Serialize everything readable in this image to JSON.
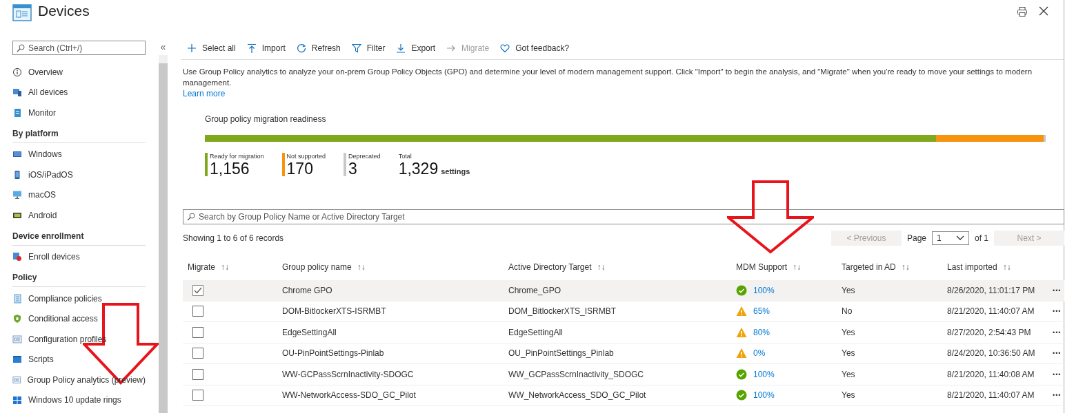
{
  "window": {
    "title": "Devices"
  },
  "sidebar": {
    "search": {
      "placeholder": "Search (Ctrl+/)"
    },
    "collapse": "«",
    "sections": [
      {
        "items": [
          {
            "label": "Overview",
            "selected": false
          },
          {
            "label": "All devices",
            "selected": false
          },
          {
            "label": "Monitor",
            "selected": false
          }
        ]
      },
      {
        "title": "By platform",
        "items": [
          {
            "label": "Windows",
            "selected": false
          },
          {
            "label": "iOS/iPadOS",
            "selected": false
          },
          {
            "label": "macOS",
            "selected": false
          },
          {
            "label": "Android",
            "selected": false
          }
        ]
      },
      {
        "title": "Device enrollment",
        "items": [
          {
            "label": "Enroll devices",
            "selected": false
          }
        ]
      },
      {
        "title": "Policy",
        "items": [
          {
            "label": "Compliance policies",
            "selected": false
          },
          {
            "label": "Conditional access",
            "selected": false
          },
          {
            "label": "Configuration profiles",
            "selected": false
          },
          {
            "label": "Scripts",
            "selected": false
          },
          {
            "label": "Group Policy analytics (preview)",
            "selected": false
          },
          {
            "label": "Windows 10 update rings",
            "selected": false
          }
        ]
      }
    ]
  },
  "toolbar": [
    {
      "label": "Select all",
      "disabled": false
    },
    {
      "label": "Import",
      "disabled": false
    },
    {
      "label": "Refresh",
      "disabled": false
    },
    {
      "label": "Filter",
      "disabled": false
    },
    {
      "label": "Export",
      "disabled": false
    },
    {
      "label": "Migrate",
      "disabled": true
    },
    {
      "label": "Got feedback?",
      "disabled": false
    }
  ],
  "description": "Use Group Policy analytics to analyze your on-prem Group Policy Objects (GPO) and determine your level of modern management support. Click \"Import\" to begin the analysis, and \"Migrate\" when you're ready to move your settings to modern management.",
  "learn_more": "Learn more",
  "readiness": {
    "title": "Group policy migration readiness",
    "segments": [
      {
        "label": "Ready for migration",
        "value": "1,156",
        "color": "#7fa81b"
      },
      {
        "label": "Not supported",
        "value": "170",
        "color": "#f7940f"
      },
      {
        "label": "Deprecated",
        "value": "3",
        "color": "#c8c8c8"
      }
    ],
    "total": {
      "label": "Total",
      "value": "1,329",
      "unit": "settings"
    }
  },
  "table": {
    "search": {
      "placeholder": "Search by Group Policy Name or Active Directory Target"
    },
    "showing": "Showing 1 to 6 of 6 records",
    "pagination": {
      "previous": {
        "label": "< Previous",
        "disabled": true
      },
      "page_label": "Page",
      "page": "1",
      "of": "of 1",
      "next": {
        "label": "Next >",
        "disabled": true
      }
    },
    "columns": [
      {
        "label": "Migrate",
        "sort": "↑↓"
      },
      {
        "label": "Group policy name",
        "sort": "↑↓"
      },
      {
        "label": "Active Directory Target",
        "sort": "↑↓"
      },
      {
        "label": "MDM Support",
        "sort": "↑↓"
      },
      {
        "label": "Targeted in AD",
        "sort": "↑↓"
      },
      {
        "label": "Last imported",
        "sort": "↑↓"
      }
    ],
    "rows": [
      {
        "selected": true,
        "checked": true,
        "name": "Chrome GPO",
        "target": "Chrome_GPO",
        "warning": false,
        "mdm": "100%",
        "targeted": "Yes",
        "imported": "8/26/2020, 11:01:17 PM",
        "more": "•••"
      },
      {
        "selected": false,
        "checked": false,
        "name": "DOM-BitlockerXTS-ISRMBT",
        "target": "DOM_BitlockerXTS_ISRMBT",
        "warning": true,
        "mdm": "65%",
        "targeted": "No",
        "imported": "8/21/2020, 11:40:07 AM",
        "more": "•••"
      },
      {
        "selected": false,
        "checked": false,
        "name": "EdgeSettingAll",
        "target": "EdgeSettingAll",
        "warning": true,
        "mdm": "80%",
        "targeted": "Yes",
        "imported": "8/27/2020, 2:54:43 PM",
        "more": "•••"
      },
      {
        "selected": false,
        "checked": false,
        "name": "OU-PinPointSettings-Pinlab",
        "target": "OU_PinPointSettings_Pinlab",
        "warning": true,
        "mdm": "0%",
        "targeted": "Yes",
        "imported": "8/24/2020, 10:36:50 AM",
        "more": "•••"
      },
      {
        "selected": false,
        "checked": false,
        "name": "WW-GCPassScrnInactivity-SDOGC",
        "target": "WW_GCPassScrnInactivity_SDOGC",
        "warning": false,
        "mdm": "100%",
        "targeted": "Yes",
        "imported": "8/21/2020, 11:40:08 AM",
        "more": "•••"
      },
      {
        "selected": false,
        "checked": false,
        "name": "WW-NetworkAccess-SDO_GC_Pilot",
        "target": "WW_NetworkAccess_SDO_GC_Pilot",
        "warning": false,
        "mdm": "100%",
        "targeted": "Yes",
        "imported": "8/21/2020, 11:40:07 AM",
        "more": "•••"
      }
    ]
  }
}
